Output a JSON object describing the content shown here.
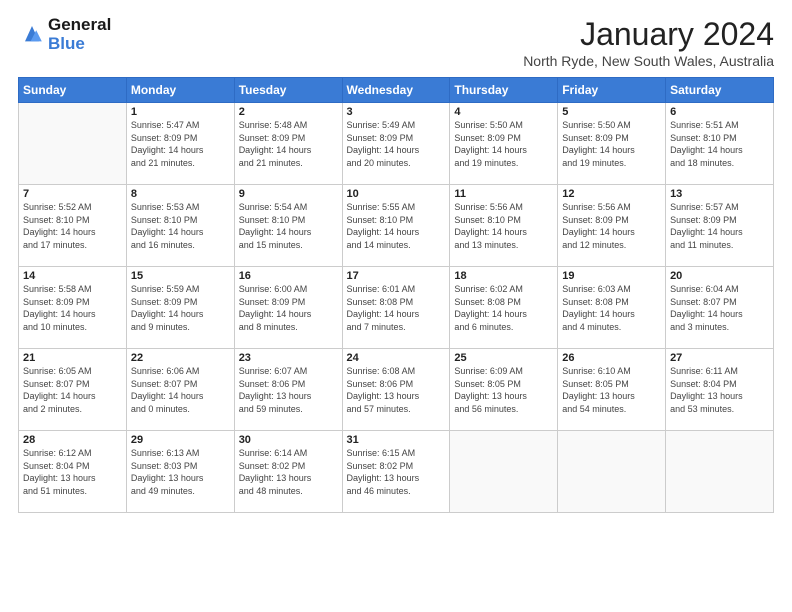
{
  "logo": {
    "line1": "General",
    "line2": "Blue"
  },
  "title": "January 2024",
  "location": "North Ryde, New South Wales, Australia",
  "days_of_week": [
    "Sunday",
    "Monday",
    "Tuesday",
    "Wednesday",
    "Thursday",
    "Friday",
    "Saturday"
  ],
  "weeks": [
    [
      {
        "day": "",
        "info": ""
      },
      {
        "day": "1",
        "info": "Sunrise: 5:47 AM\nSunset: 8:09 PM\nDaylight: 14 hours\nand 21 minutes."
      },
      {
        "day": "2",
        "info": "Sunrise: 5:48 AM\nSunset: 8:09 PM\nDaylight: 14 hours\nand 21 minutes."
      },
      {
        "day": "3",
        "info": "Sunrise: 5:49 AM\nSunset: 8:09 PM\nDaylight: 14 hours\nand 20 minutes."
      },
      {
        "day": "4",
        "info": "Sunrise: 5:50 AM\nSunset: 8:09 PM\nDaylight: 14 hours\nand 19 minutes."
      },
      {
        "day": "5",
        "info": "Sunrise: 5:50 AM\nSunset: 8:09 PM\nDaylight: 14 hours\nand 19 minutes."
      },
      {
        "day": "6",
        "info": "Sunrise: 5:51 AM\nSunset: 8:10 PM\nDaylight: 14 hours\nand 18 minutes."
      }
    ],
    [
      {
        "day": "7",
        "info": "Sunrise: 5:52 AM\nSunset: 8:10 PM\nDaylight: 14 hours\nand 17 minutes."
      },
      {
        "day": "8",
        "info": "Sunrise: 5:53 AM\nSunset: 8:10 PM\nDaylight: 14 hours\nand 16 minutes."
      },
      {
        "day": "9",
        "info": "Sunrise: 5:54 AM\nSunset: 8:10 PM\nDaylight: 14 hours\nand 15 minutes."
      },
      {
        "day": "10",
        "info": "Sunrise: 5:55 AM\nSunset: 8:10 PM\nDaylight: 14 hours\nand 14 minutes."
      },
      {
        "day": "11",
        "info": "Sunrise: 5:56 AM\nSunset: 8:10 PM\nDaylight: 14 hours\nand 13 minutes."
      },
      {
        "day": "12",
        "info": "Sunrise: 5:56 AM\nSunset: 8:09 PM\nDaylight: 14 hours\nand 12 minutes."
      },
      {
        "day": "13",
        "info": "Sunrise: 5:57 AM\nSunset: 8:09 PM\nDaylight: 14 hours\nand 11 minutes."
      }
    ],
    [
      {
        "day": "14",
        "info": "Sunrise: 5:58 AM\nSunset: 8:09 PM\nDaylight: 14 hours\nand 10 minutes."
      },
      {
        "day": "15",
        "info": "Sunrise: 5:59 AM\nSunset: 8:09 PM\nDaylight: 14 hours\nand 9 minutes."
      },
      {
        "day": "16",
        "info": "Sunrise: 6:00 AM\nSunset: 8:09 PM\nDaylight: 14 hours\nand 8 minutes."
      },
      {
        "day": "17",
        "info": "Sunrise: 6:01 AM\nSunset: 8:08 PM\nDaylight: 14 hours\nand 7 minutes."
      },
      {
        "day": "18",
        "info": "Sunrise: 6:02 AM\nSunset: 8:08 PM\nDaylight: 14 hours\nand 6 minutes."
      },
      {
        "day": "19",
        "info": "Sunrise: 6:03 AM\nSunset: 8:08 PM\nDaylight: 14 hours\nand 4 minutes."
      },
      {
        "day": "20",
        "info": "Sunrise: 6:04 AM\nSunset: 8:07 PM\nDaylight: 14 hours\nand 3 minutes."
      }
    ],
    [
      {
        "day": "21",
        "info": "Sunrise: 6:05 AM\nSunset: 8:07 PM\nDaylight: 14 hours\nand 2 minutes."
      },
      {
        "day": "22",
        "info": "Sunrise: 6:06 AM\nSunset: 8:07 PM\nDaylight: 14 hours\nand 0 minutes."
      },
      {
        "day": "23",
        "info": "Sunrise: 6:07 AM\nSunset: 8:06 PM\nDaylight: 13 hours\nand 59 minutes."
      },
      {
        "day": "24",
        "info": "Sunrise: 6:08 AM\nSunset: 8:06 PM\nDaylight: 13 hours\nand 57 minutes."
      },
      {
        "day": "25",
        "info": "Sunrise: 6:09 AM\nSunset: 8:05 PM\nDaylight: 13 hours\nand 56 minutes."
      },
      {
        "day": "26",
        "info": "Sunrise: 6:10 AM\nSunset: 8:05 PM\nDaylight: 13 hours\nand 54 minutes."
      },
      {
        "day": "27",
        "info": "Sunrise: 6:11 AM\nSunset: 8:04 PM\nDaylight: 13 hours\nand 53 minutes."
      }
    ],
    [
      {
        "day": "28",
        "info": "Sunrise: 6:12 AM\nSunset: 8:04 PM\nDaylight: 13 hours\nand 51 minutes."
      },
      {
        "day": "29",
        "info": "Sunrise: 6:13 AM\nSunset: 8:03 PM\nDaylight: 13 hours\nand 49 minutes."
      },
      {
        "day": "30",
        "info": "Sunrise: 6:14 AM\nSunset: 8:02 PM\nDaylight: 13 hours\nand 48 minutes."
      },
      {
        "day": "31",
        "info": "Sunrise: 6:15 AM\nSunset: 8:02 PM\nDaylight: 13 hours\nand 46 minutes."
      },
      {
        "day": "",
        "info": ""
      },
      {
        "day": "",
        "info": ""
      },
      {
        "day": "",
        "info": ""
      }
    ]
  ]
}
